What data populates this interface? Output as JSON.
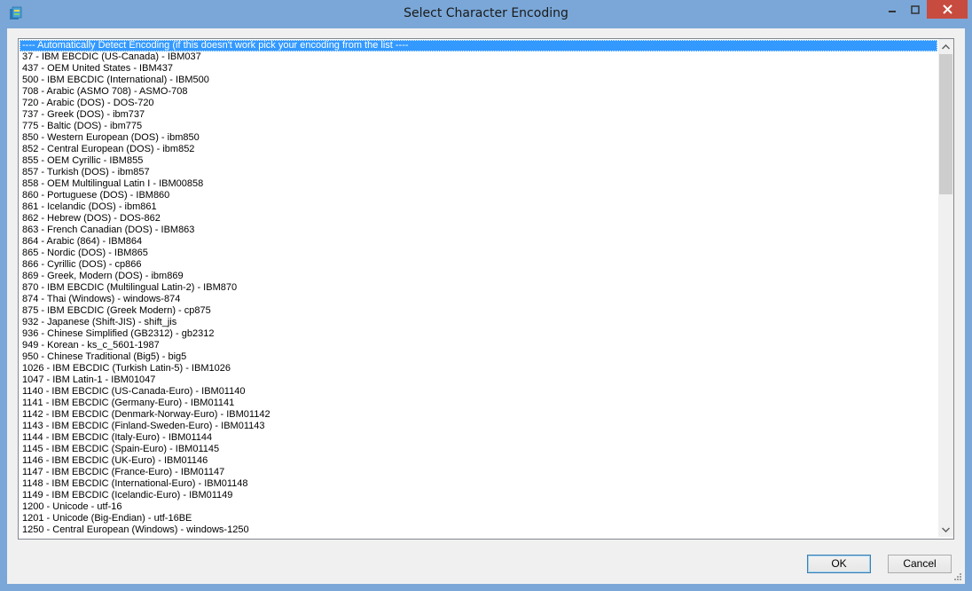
{
  "window": {
    "title": "Select Character Encoding",
    "icons": {
      "app": "app-icon",
      "minimize": "minimize-icon",
      "maximize": "maximize-icon",
      "close": "close-icon"
    }
  },
  "list": {
    "selected_index": 0,
    "items": [
      "---- Automatically Detect Encoding (if this doesn't work pick your encoding from the list ----",
      "37 - IBM EBCDIC (US-Canada) - IBM037",
      "437 - OEM United States - IBM437",
      "500 - IBM EBCDIC (International) - IBM500",
      "708 - Arabic (ASMO 708) - ASMO-708",
      "720 - Arabic (DOS) - DOS-720",
      "737 - Greek (DOS) - ibm737",
      "775 - Baltic (DOS) - ibm775",
      "850 - Western European (DOS) - ibm850",
      "852 - Central European (DOS) - ibm852",
      "855 - OEM Cyrillic - IBM855",
      "857 - Turkish (DOS) - ibm857",
      "858 - OEM Multilingual Latin I - IBM00858",
      "860 - Portuguese (DOS) - IBM860",
      "861 - Icelandic (DOS) - ibm861",
      "862 - Hebrew (DOS) - DOS-862",
      "863 - French Canadian (DOS) - IBM863",
      "864 - Arabic (864) - IBM864",
      "865 - Nordic (DOS) - IBM865",
      "866 - Cyrillic (DOS) - cp866",
      "869 - Greek, Modern (DOS) - ibm869",
      "870 - IBM EBCDIC (Multilingual Latin-2) - IBM870",
      "874 - Thai (Windows) - windows-874",
      "875 - IBM EBCDIC (Greek Modern) - cp875",
      "932 - Japanese (Shift-JIS) - shift_jis",
      "936 - Chinese Simplified (GB2312) - gb2312",
      "949 - Korean - ks_c_5601-1987",
      "950 - Chinese Traditional (Big5) - big5",
      "1026 - IBM EBCDIC (Turkish Latin-5) - IBM1026",
      "1047 - IBM Latin-1 - IBM01047",
      "1140 - IBM EBCDIC (US-Canada-Euro) - IBM01140",
      "1141 - IBM EBCDIC (Germany-Euro) - IBM01141",
      "1142 - IBM EBCDIC (Denmark-Norway-Euro) - IBM01142",
      "1143 - IBM EBCDIC (Finland-Sweden-Euro) - IBM01143",
      "1144 - IBM EBCDIC (Italy-Euro) - IBM01144",
      "1145 - IBM EBCDIC (Spain-Euro) - IBM01145",
      "1146 - IBM EBCDIC (UK-Euro) - IBM01146",
      "1147 - IBM EBCDIC (France-Euro) - IBM01147",
      "1148 - IBM EBCDIC (International-Euro) - IBM01148",
      "1149 - IBM EBCDIC (Icelandic-Euro) - IBM01149",
      "1200 - Unicode - utf-16",
      "1201 - Unicode (Big-Endian) - utf-16BE",
      "1250 - Central European (Windows) - windows-1250"
    ]
  },
  "buttons": {
    "ok": "OK",
    "cancel": "Cancel"
  },
  "colors": {
    "frame": "#7aa7d8",
    "selection": "#3399ff",
    "close": "#c74b3e"
  }
}
